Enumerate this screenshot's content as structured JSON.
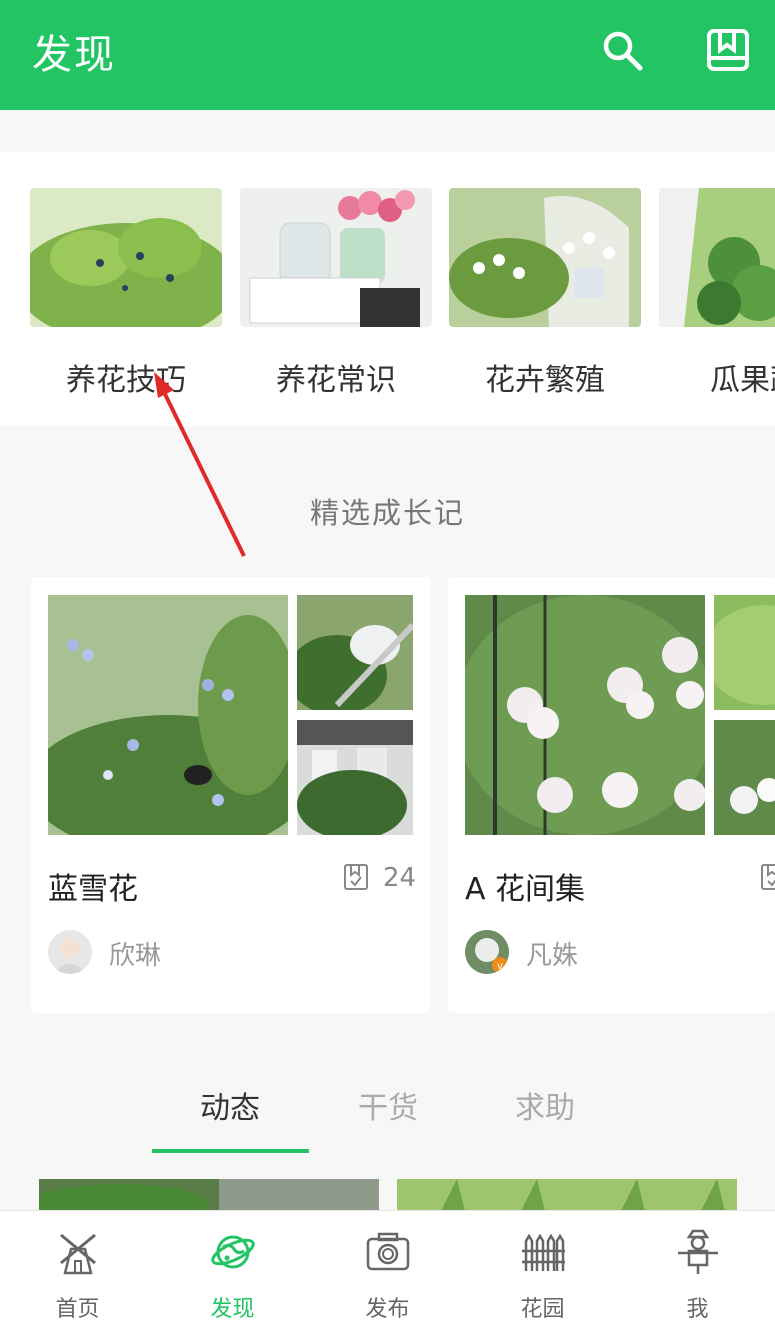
{
  "header": {
    "title": "发现",
    "icons": [
      "search-icon",
      "bookmark-icon"
    ],
    "color": "#22c464"
  },
  "categories": [
    {
      "label": "养花技巧"
    },
    {
      "label": "养花常识"
    },
    {
      "label": "花卉繁殖"
    },
    {
      "label": "瓜果蔬"
    }
  ],
  "featured": {
    "title": "精选成长记",
    "diaries": [
      {
        "name": "蓝雪花",
        "count": "24",
        "author": "欣琳"
      },
      {
        "name": "A 花间集",
        "count": "",
        "author": "凡姝"
      }
    ]
  },
  "tabs": [
    {
      "label": "动态",
      "active": true
    },
    {
      "label": "干货",
      "active": false
    },
    {
      "label": "求助",
      "active": false
    }
  ],
  "nav": [
    {
      "label": "首页",
      "icon": "windmill-icon"
    },
    {
      "label": "发现",
      "icon": "planet-icon",
      "active": true
    },
    {
      "label": "发布",
      "icon": "camera-icon"
    },
    {
      "label": "花园",
      "icon": "fence-icon"
    },
    {
      "label": "我",
      "icon": "scarecrow-icon"
    }
  ]
}
